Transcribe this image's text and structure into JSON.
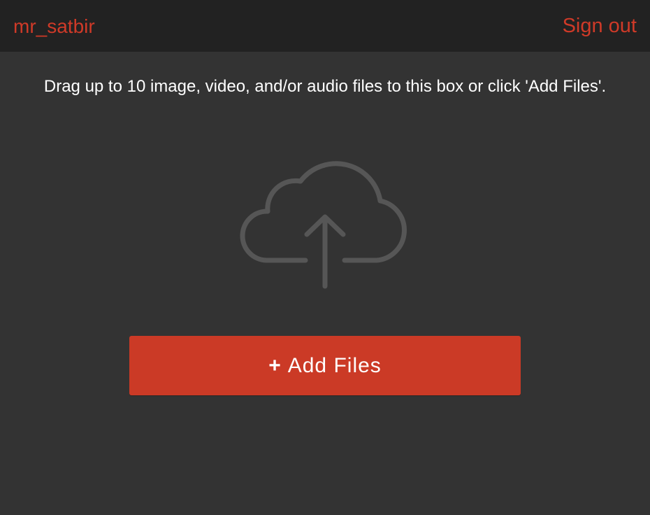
{
  "header": {
    "username": "mr_satbir",
    "signout_label": "Sign out"
  },
  "dropzone": {
    "instructions": "Drag up to 10 image, video, and/or audio files to this box or click 'Add Files'.",
    "icon": "cloud-upload-icon",
    "add_button": {
      "icon_glyph": "+",
      "label": "Add Files"
    }
  },
  "colors": {
    "background": "#333333",
    "header_background": "#222222",
    "accent": "#cb3a26",
    "icon_stroke": "#555555",
    "text": "#ffffff"
  }
}
